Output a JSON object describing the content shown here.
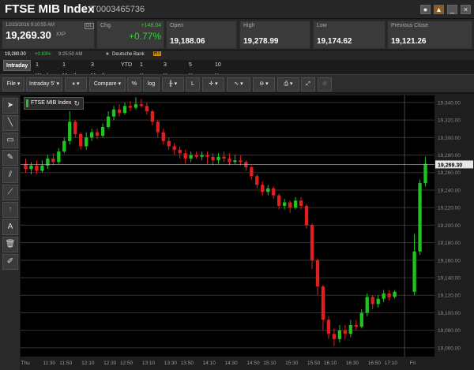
{
  "header": {
    "title": "FTSE MIB Index",
    "code": "/ IT0003465736"
  },
  "quote": {
    "datetime": "12/23/2016 9:10:55 AM",
    "dl": "DL",
    "last": "19,269.30",
    "currency": "XXP",
    "ref_price": "19,280.00",
    "ref_change": "+0.83%",
    "ref_time": "9:25:50 AM",
    "source": "Deutsche Bank",
    "rt": "RT",
    "chg_label": "Chg.",
    "chg_abs": "+148.04",
    "chg_pct": "+0.77%",
    "open_label": "Open",
    "open": "19,188.06",
    "high_label": "High",
    "high": "19,278.99",
    "low_label": "Low",
    "low": "19,174.62",
    "prev_label": "Previous Close",
    "prev": "19,121.26"
  },
  "tabs": [
    "Intraday",
    "1 Week",
    "1 Month",
    "3 Months",
    "YTD",
    "1 Year",
    "3 Years",
    "5 Years",
    "10 Years"
  ],
  "toolbar": {
    "file": "File",
    "interval": "Intraday 5'",
    "compare": "Compare",
    "pct": "%",
    "log": "log",
    "l": "L"
  },
  "lefttools": [
    "pointer",
    "line",
    "rect",
    "pen",
    "channel",
    "fib",
    "arrow",
    "text",
    "trash",
    "edit"
  ],
  "colors": {
    "up": "#1fc41f",
    "down": "#e02020",
    "bg": "#000000",
    "grid": "#333333"
  },
  "chart_data": {
    "type": "candlestick",
    "legend": "FTSE MIB Index",
    "current_label": "19,269.30",
    "y_ticks": [
      "19,340.00",
      "19,320.00",
      "19,300.00",
      "19,280.00",
      "19,260.00",
      "19,240.00",
      "19,220.00",
      "19,200.00",
      "19,180.00",
      "19,160.00",
      "19,140.00",
      "19,120.00",
      "19,100.00",
      "19,080.00",
      "19,060.00"
    ],
    "ylim": [
      19050,
      19348
    ],
    "x_ticks": [
      "Thu",
      "11:30",
      "11:50",
      "12:10",
      "12:30",
      "12:50",
      "13:10",
      "13:30",
      "13:50",
      "14:10",
      "14:30",
      "14:50",
      "15:10",
      "15:30",
      "15:50",
      "16:10",
      "16:30",
      "16:50",
      "17:10",
      "Fri"
    ],
    "current_value": 19269.3,
    "candles": [
      [
        19270,
        19264,
        19276,
        19260
      ],
      [
        19264,
        19268,
        19272,
        19258
      ],
      [
        19268,
        19262,
        19274,
        19258
      ],
      [
        19262,
        19268,
        19274,
        19260
      ],
      [
        19268,
        19276,
        19280,
        19264
      ],
      [
        19276,
        19272,
        19282,
        19268
      ],
      [
        19272,
        19284,
        19288,
        19270
      ],
      [
        19284,
        19296,
        19300,
        19282
      ],
      [
        19296,
        19318,
        19330,
        19292
      ],
      [
        19318,
        19304,
        19320,
        19300
      ],
      [
        19304,
        19290,
        19306,
        19286
      ],
      [
        19290,
        19300,
        19306,
        19286
      ],
      [
        19300,
        19306,
        19310,
        19296
      ],
      [
        19306,
        19302,
        19310,
        19298
      ],
      [
        19302,
        19312,
        19316,
        19300
      ],
      [
        19312,
        19324,
        19330,
        19310
      ],
      [
        19324,
        19332,
        19336,
        19320
      ],
      [
        19332,
        19328,
        19338,
        19324
      ],
      [
        19328,
        19336,
        19340,
        19326
      ],
      [
        19336,
        19334,
        19342,
        19330
      ],
      [
        19334,
        19338,
        19346,
        19332
      ],
      [
        19338,
        19336,
        19344,
        19334
      ],
      [
        19336,
        19330,
        19340,
        19326
      ],
      [
        19330,
        19318,
        19332,
        19314
      ],
      [
        19318,
        19306,
        19320,
        19300
      ],
      [
        19306,
        19296,
        19310,
        19292
      ],
      [
        19296,
        19290,
        19300,
        19286
      ],
      [
        19290,
        19286,
        19294,
        19280
      ],
      [
        19286,
        19282,
        19290,
        19276
      ],
      [
        19282,
        19276,
        19286,
        19270
      ],
      [
        19276,
        19280,
        19284,
        19272
      ],
      [
        19280,
        19278,
        19284,
        19276
      ],
      [
        19278,
        19280,
        19284,
        19274
      ],
      [
        19280,
        19278,
        19284,
        19270
      ],
      [
        19278,
        19274,
        19282,
        19268
      ],
      [
        19274,
        19278,
        19282,
        19270
      ],
      [
        19278,
        19276,
        19284,
        19272
      ],
      [
        19276,
        19272,
        19282,
        19268
      ],
      [
        19272,
        19274,
        19280,
        19270
      ],
      [
        19274,
        19272,
        19280,
        19268
      ],
      [
        19272,
        19266,
        19274,
        19262
      ],
      [
        19266,
        19256,
        19268,
        19252
      ],
      [
        19256,
        19246,
        19258,
        19242
      ],
      [
        19246,
        19238,
        19250,
        19234
      ],
      [
        19238,
        19242,
        19246,
        19234
      ],
      [
        19242,
        19234,
        19244,
        19230
      ],
      [
        19234,
        19222,
        19236,
        19218
      ],
      [
        19222,
        19226,
        19230,
        19218
      ],
      [
        19226,
        19220,
        19228,
        19214
      ],
      [
        19220,
        19228,
        19232,
        19218
      ],
      [
        19228,
        19222,
        19232,
        19218
      ],
      [
        19222,
        19200,
        19224,
        19196
      ],
      [
        19200,
        19160,
        19202,
        19150
      ],
      [
        19160,
        19130,
        19162,
        19120
      ],
      [
        19130,
        19092,
        19132,
        19080
      ],
      [
        19092,
        19076,
        19096,
        19070
      ],
      [
        19076,
        19070,
        19082,
        19062
      ],
      [
        19070,
        19080,
        19086,
        19066
      ],
      [
        19080,
        19076,
        19086,
        19070
      ],
      [
        19076,
        19086,
        19092,
        19072
      ],
      [
        19086,
        19084,
        19092,
        19080
      ],
      [
        19084,
        19100,
        19104,
        19082
      ],
      [
        19100,
        19118,
        19122,
        19096
      ],
      [
        19118,
        19110,
        19120,
        19104
      ],
      [
        19110,
        19116,
        19120,
        19106
      ],
      [
        19116,
        19122,
        19126,
        19112
      ],
      [
        19122,
        19118,
        19126,
        19114
      ],
      [
        19118,
        19124,
        19126,
        19116
      ],
      [
        19124,
        19170,
        19190,
        19120
      ],
      [
        19170,
        19248,
        19252,
        19166
      ],
      [
        19248,
        19270,
        19278,
        19244
      ]
    ]
  }
}
